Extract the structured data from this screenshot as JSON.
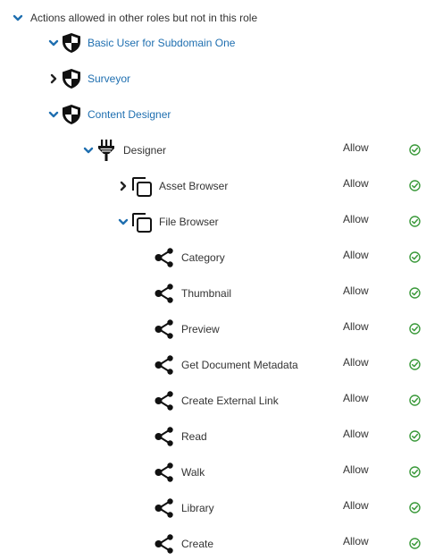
{
  "section": {
    "title": "Actions allowed in other roles but not in this role"
  },
  "roles": [
    {
      "label": "Basic User for Subdomain One",
      "expanded": true,
      "icon": "shield-icon"
    },
    {
      "label": "Surveyor",
      "expanded": false,
      "icon": "shield-icon"
    },
    {
      "label": "Content Designer",
      "expanded": true,
      "icon": "shield-icon"
    }
  ],
  "designer": {
    "label": "Designer",
    "permission": "Allow",
    "icon": "plug-icon"
  },
  "components": [
    {
      "label": "Asset Browser",
      "permission": "Allow",
      "expanded": false,
      "icon": "copy-icon"
    },
    {
      "label": "File Browser",
      "permission": "Allow",
      "expanded": true,
      "icon": "copy-icon"
    }
  ],
  "actions": [
    {
      "label": "Category",
      "permission": "Allow"
    },
    {
      "label": "Thumbnail",
      "permission": "Allow"
    },
    {
      "label": "Preview",
      "permission": "Allow"
    },
    {
      "label": "Get Document Metadata",
      "permission": "Allow"
    },
    {
      "label": "Create External Link",
      "permission": "Allow"
    },
    {
      "label": "Read",
      "permission": "Allow"
    },
    {
      "label": "Walk",
      "permission": "Allow"
    },
    {
      "label": "Library",
      "permission": "Allow"
    },
    {
      "label": "Create",
      "permission": "Allow"
    }
  ],
  "colors": {
    "link": "#1f6fb0",
    "chevron_expanded": "#1f6fb0",
    "chevron_collapsed": "#222222",
    "icon": "#111111",
    "allowed": "#3c9a3c"
  }
}
